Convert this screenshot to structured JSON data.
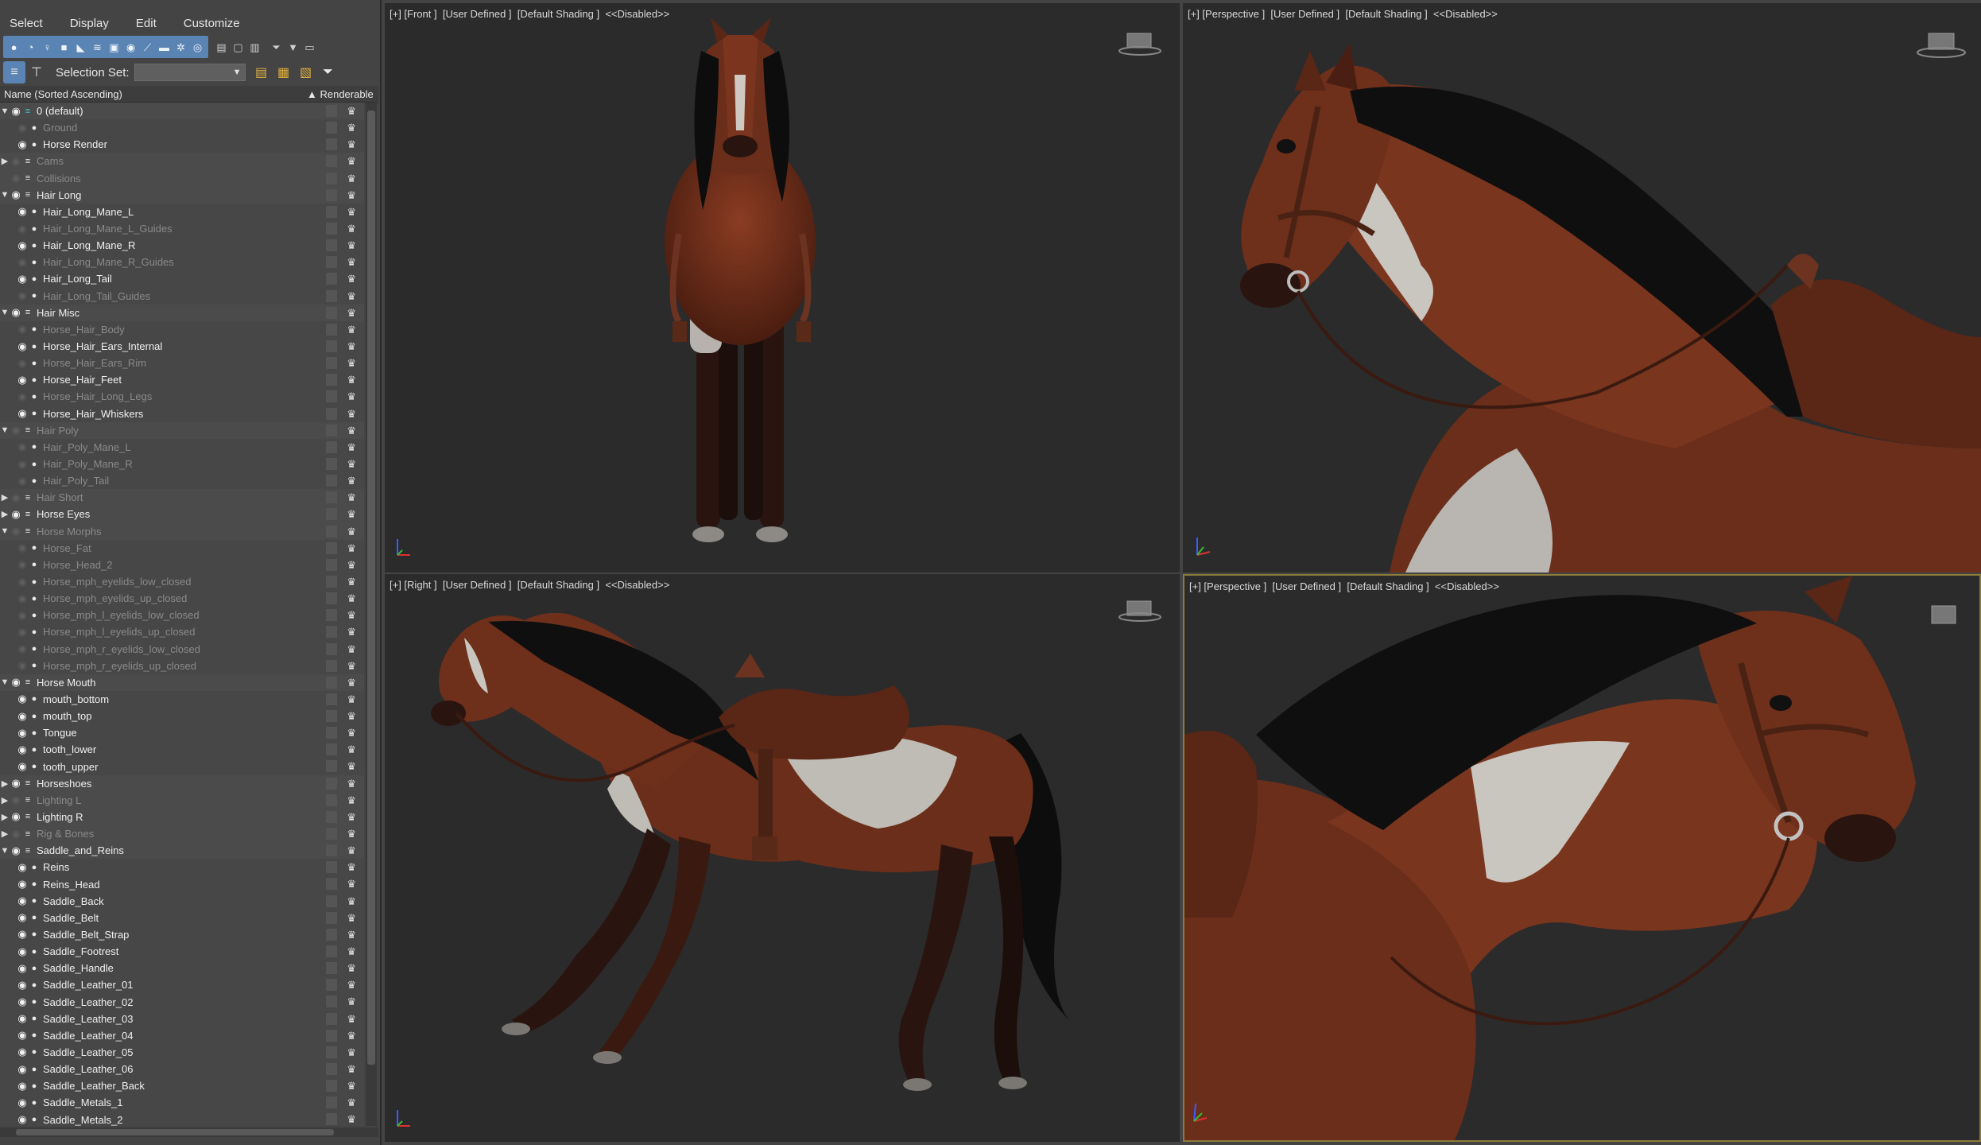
{
  "menu": [
    "Select",
    "Display",
    "Edit",
    "Customize"
  ],
  "toolbar": {
    "selection_set_label": "Selection Set:",
    "selection_set_value": ""
  },
  "columns": {
    "name": "Name (Sorted Ascending)",
    "renderable": "▲ Renderable"
  },
  "tree": [
    {
      "label": "0 (default)",
      "type": "layer",
      "level": 0,
      "expander": "open",
      "visible": true
    },
    {
      "label": "Ground",
      "type": "object",
      "level": 1,
      "visible": false
    },
    {
      "label": "Horse Render",
      "type": "object",
      "level": 1,
      "visible": true
    },
    {
      "label": "Cams",
      "type": "layer",
      "level": 0,
      "expander": "closed",
      "visible": false
    },
    {
      "label": "Collisions",
      "type": "layer",
      "level": 0,
      "expander": "none",
      "visible": false
    },
    {
      "label": "Hair Long",
      "type": "layer",
      "level": 0,
      "expander": "open",
      "visible": true
    },
    {
      "label": "Hair_Long_Mane_L",
      "type": "object",
      "level": 1,
      "visible": true
    },
    {
      "label": "Hair_Long_Mane_L_Guides",
      "type": "object",
      "level": 1,
      "visible": false
    },
    {
      "label": "Hair_Long_Mane_R",
      "type": "object",
      "level": 1,
      "visible": true
    },
    {
      "label": "Hair_Long_Mane_R_Guides",
      "type": "object",
      "level": 1,
      "visible": false
    },
    {
      "label": "Hair_Long_Tail",
      "type": "object",
      "level": 1,
      "visible": true
    },
    {
      "label": "Hair_Long_Tail_Guides",
      "type": "object",
      "level": 1,
      "visible": false
    },
    {
      "label": "Hair Misc",
      "type": "layer",
      "level": 0,
      "expander": "open",
      "visible": true
    },
    {
      "label": "Horse_Hair_Body",
      "type": "object",
      "level": 1,
      "visible": false
    },
    {
      "label": "Horse_Hair_Ears_Internal",
      "type": "object",
      "level": 1,
      "visible": true
    },
    {
      "label": "Horse_Hair_Ears_Rim",
      "type": "object",
      "level": 1,
      "visible": false
    },
    {
      "label": "Horse_Hair_Feet",
      "type": "object",
      "level": 1,
      "visible": true
    },
    {
      "label": "Horse_Hair_Long_Legs",
      "type": "object",
      "level": 1,
      "visible": false
    },
    {
      "label": "Horse_Hair_Whiskers",
      "type": "object",
      "level": 1,
      "visible": true
    },
    {
      "label": "Hair Poly",
      "type": "layer",
      "level": 0,
      "expander": "open",
      "visible": false
    },
    {
      "label": "Hair_Poly_Mane_L",
      "type": "object",
      "level": 1,
      "visible": false
    },
    {
      "label": "Hair_Poly_Mane_R",
      "type": "object",
      "level": 1,
      "visible": false
    },
    {
      "label": "Hair_Poly_Tail",
      "type": "object",
      "level": 1,
      "visible": false
    },
    {
      "label": "Hair Short",
      "type": "layer",
      "level": 0,
      "expander": "closed",
      "visible": false
    },
    {
      "label": "Horse Eyes",
      "type": "layer",
      "level": 0,
      "expander": "closed",
      "visible": true
    },
    {
      "label": "Horse Morphs",
      "type": "layer",
      "level": 0,
      "expander": "open",
      "visible": false
    },
    {
      "label": "Horse_Fat",
      "type": "object",
      "level": 1,
      "visible": false
    },
    {
      "label": "Horse_Head_2",
      "type": "object",
      "level": 1,
      "visible": false
    },
    {
      "label": "Horse_mph_eyelids_low_closed",
      "type": "object",
      "level": 1,
      "visible": false
    },
    {
      "label": "Horse_mph_eyelids_up_closed",
      "type": "object",
      "level": 1,
      "visible": false
    },
    {
      "label": "Horse_mph_l_eyelids_low_closed",
      "type": "object",
      "level": 1,
      "visible": false
    },
    {
      "label": "Horse_mph_l_eyelids_up_closed",
      "type": "object",
      "level": 1,
      "visible": false
    },
    {
      "label": "Horse_mph_r_eyelids_low_closed",
      "type": "object",
      "level": 1,
      "visible": false
    },
    {
      "label": "Horse_mph_r_eyelids_up_closed",
      "type": "object",
      "level": 1,
      "visible": false
    },
    {
      "label": "Horse Mouth",
      "type": "layer",
      "level": 0,
      "expander": "open",
      "visible": true
    },
    {
      "label": "mouth_bottom",
      "type": "object",
      "level": 1,
      "visible": true
    },
    {
      "label": "mouth_top",
      "type": "object",
      "level": 1,
      "visible": true
    },
    {
      "label": "Tongue",
      "type": "object",
      "level": 1,
      "visible": true
    },
    {
      "label": "tooth_lower",
      "type": "object",
      "level": 1,
      "visible": true
    },
    {
      "label": "tooth_upper",
      "type": "object",
      "level": 1,
      "visible": true
    },
    {
      "label": "Horseshoes",
      "type": "layer",
      "level": 0,
      "expander": "closed",
      "visible": true
    },
    {
      "label": "Lighting L",
      "type": "layer",
      "level": 0,
      "expander": "closed",
      "visible": false
    },
    {
      "label": "Lighting R",
      "type": "layer",
      "level": 0,
      "expander": "closed",
      "visible": true
    },
    {
      "label": "Rig & Bones",
      "type": "layer",
      "level": 0,
      "expander": "closed",
      "visible": false
    },
    {
      "label": "Saddle_and_Reins",
      "type": "layer",
      "level": 0,
      "expander": "open",
      "visible": true
    },
    {
      "label": "Reins",
      "type": "object",
      "level": 1,
      "visible": true
    },
    {
      "label": "Reins_Head",
      "type": "object",
      "level": 1,
      "visible": true
    },
    {
      "label": "Saddle_Back",
      "type": "object",
      "level": 1,
      "visible": true
    },
    {
      "label": "Saddle_Belt",
      "type": "object",
      "level": 1,
      "visible": true
    },
    {
      "label": "Saddle_Belt_Strap",
      "type": "object",
      "level": 1,
      "visible": true
    },
    {
      "label": "Saddle_Footrest",
      "type": "object",
      "level": 1,
      "visible": true
    },
    {
      "label": "Saddle_Handle",
      "type": "object",
      "level": 1,
      "visible": true
    },
    {
      "label": "Saddle_Leather_01",
      "type": "object",
      "level": 1,
      "visible": true
    },
    {
      "label": "Saddle_Leather_02",
      "type": "object",
      "level": 1,
      "visible": true
    },
    {
      "label": "Saddle_Leather_03",
      "type": "object",
      "level": 1,
      "visible": true
    },
    {
      "label": "Saddle_Leather_04",
      "type": "object",
      "level": 1,
      "visible": true
    },
    {
      "label": "Saddle_Leather_05",
      "type": "object",
      "level": 1,
      "visible": true
    },
    {
      "label": "Saddle_Leather_06",
      "type": "object",
      "level": 1,
      "visible": true
    },
    {
      "label": "Saddle_Leather_Back",
      "type": "object",
      "level": 1,
      "visible": true
    },
    {
      "label": "Saddle_Metals_1",
      "type": "object",
      "level": 1,
      "visible": true
    },
    {
      "label": "Saddle_Metals_2",
      "type": "object",
      "level": 1,
      "visible": true
    }
  ],
  "viewports": {
    "front": {
      "label": "[+] [Front ]  [User Defined ]  [Default Shading ]  <<Disabled>>"
    },
    "perspective_top": {
      "label": "[+] [Perspective ]  [User Defined ]  [Default Shading ]  <<Disabled>>"
    },
    "right": {
      "label": "[+] [Right ]  [User Defined ]  [Default Shading ]  <<Disabled>>"
    },
    "perspective_bottom": {
      "label": "[+] [Perspective ]  [User Defined ]  [Default Shading ]  <<Disabled>>"
    }
  },
  "colors": {
    "accent": "#5a84b4",
    "viewport_bg": "#2b2b2b",
    "active_viewport_border": "#8c7b3a",
    "horse_coat": "#6b2e1a",
    "horse_white_patch": "#b9b6b2",
    "mane": "#111111"
  }
}
